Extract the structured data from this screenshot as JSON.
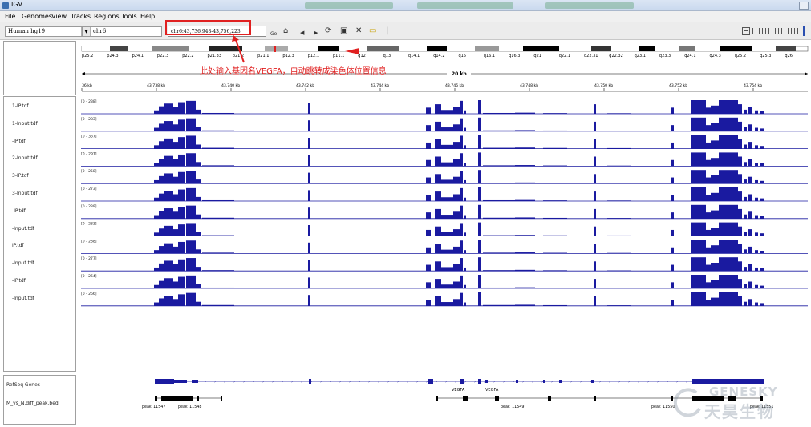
{
  "window": {
    "title": "IGV"
  },
  "menu": {
    "items": [
      "File",
      "Genomes",
      "View",
      "Tracks",
      "Regions",
      "Tools",
      "Help"
    ]
  },
  "toolbar": {
    "genome": "Human hg19",
    "chromosome": "chr6",
    "locus": "chr6:43,736,948-43,756,223",
    "go_label": "Go"
  },
  "annotation": {
    "text": "此处输入基因名VEGFA，自动跳转成染色体位置信息"
  },
  "ideogram": {
    "bands": [
      "p25.2",
      "p24.3",
      "p24.1",
      "p22.3",
      "p22.2",
      "p21.33",
      "p21.2",
      "p21.1",
      "p12.3",
      "p12.1",
      "p11.1",
      "q12",
      "q13",
      "q14.1",
      "q14.2",
      "q15",
      "q16.1",
      "q16.3",
      "q21",
      "q22.1",
      "q22.31",
      "q22.32",
      "q23.1",
      "q23.3",
      "q24.1",
      "q24.3",
      "q25.2",
      "q25.3",
      "q26"
    ]
  },
  "ruler": {
    "span_label": "20 kb",
    "ticks": [
      "36 kb",
      "43,738 kb",
      "43,740 kb",
      "43,742 kb",
      "43,744 kb",
      "43,746 kb",
      "43,748 kb",
      "43,750 kb",
      "43,752 kb",
      "43,754 kb"
    ]
  },
  "tracks": [
    {
      "name": "1-IP.tdf",
      "range": "[0 - 238]"
    },
    {
      "name": "1-Input.tdf",
      "range": "[0 - 283]"
    },
    {
      "name": "-IP.tdf",
      "range": "[0 - 367]"
    },
    {
      "name": "2-Input.tdf",
      "range": "[0 - 297]"
    },
    {
      "name": "3-IP.tdf",
      "range": "[0 - 258]"
    },
    {
      "name": "3-Input.tdf",
      "range": "[0 - 273]"
    },
    {
      "name": "-IP.tdf",
      "range": "[0 - 239]"
    },
    {
      "name": "-Input.tdf",
      "range": "[0 - 283]"
    },
    {
      "name": "IP.tdf",
      "range": "[0 - 288]"
    },
    {
      "name": "-Input.tdf",
      "range": "[0 - 277]"
    },
    {
      "name": "-IP.tdf",
      "range": "[0 - 264]"
    },
    {
      "name": "-Input.tdf",
      "range": "[0 - 266]"
    }
  ],
  "genes": {
    "track_name": "RefSeq Genes",
    "labels": [
      "VEGFA",
      "VEGFA"
    ]
  },
  "peaks": {
    "track_name": "M_vs_N.diff_peak.bed",
    "labels": [
      "peak_11547",
      "peak_11548",
      "peak_11549",
      "peak_11550",
      "peak_11551"
    ]
  },
  "watermark": {
    "en": "GENESKY",
    "cn": "天昊生物"
  },
  "colors": {
    "signal": "#1a1aa0",
    "annotation": "#e02020"
  }
}
